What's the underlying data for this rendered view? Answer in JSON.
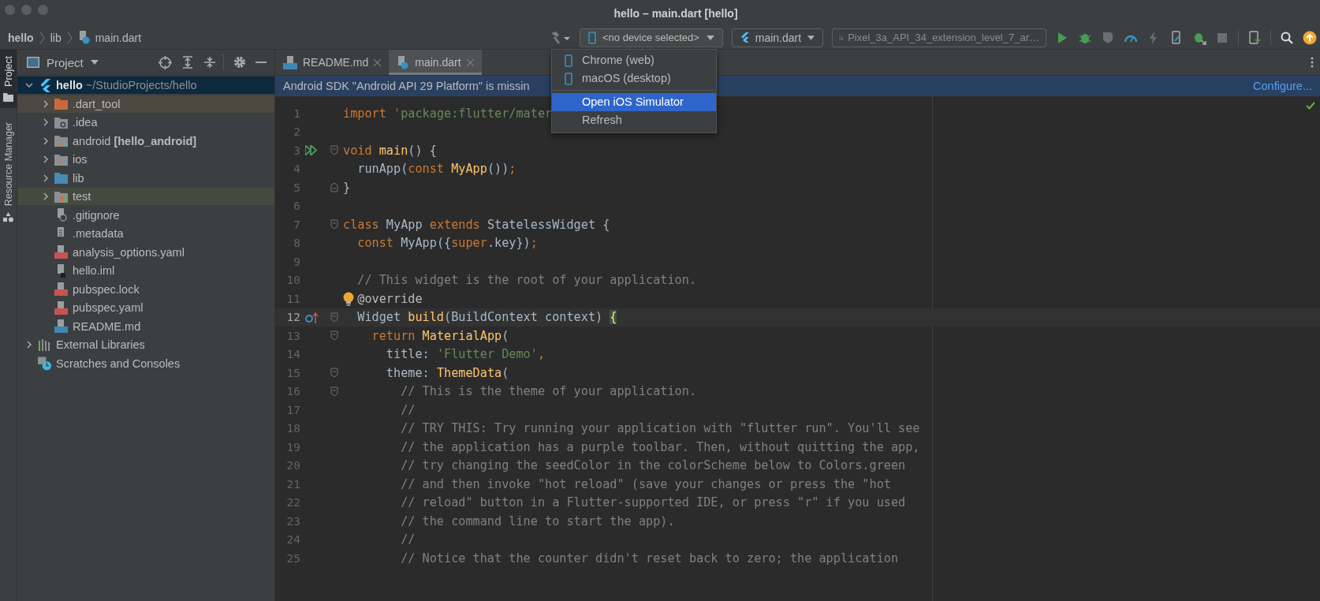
{
  "window": {
    "title": "hello – main.dart [hello]"
  },
  "breadcrumb": [
    {
      "kind": "project",
      "label": "hello"
    },
    {
      "kind": "folder",
      "label": "lib"
    },
    {
      "kind": "file",
      "label": "main.dart"
    }
  ],
  "toolbar": {
    "device_selector": {
      "label": "<no device selected>",
      "expanded": true
    },
    "run_config": "main.dart",
    "target_device": "Pixel_3a_API_34_extension_level_7_ar…",
    "actions": [
      {
        "kind": "run",
        "disabled": false
      },
      {
        "kind": "debug",
        "disabled": false
      },
      {
        "kind": "coverage",
        "disabled": true
      },
      {
        "kind": "profile",
        "disabled": false
      },
      {
        "kind": "hot-reload",
        "disabled": true
      },
      {
        "kind": "device-edit",
        "disabled": false
      },
      {
        "kind": "attach",
        "disabled": false
      },
      {
        "kind": "stop",
        "disabled": true
      },
      {
        "kind": "device-mirror",
        "disabled": false
      },
      {
        "kind": "search",
        "disabled": false
      },
      {
        "kind": "update",
        "disabled": false
      }
    ]
  },
  "device_menu": [
    {
      "kind": "device",
      "label": "Chrome (web)",
      "selected": false
    },
    {
      "kind": "device",
      "label": "macOS (desktop)",
      "selected": false
    },
    {
      "kind": "action",
      "label": "Open iOS Simulator",
      "selected": true
    },
    {
      "kind": "action",
      "label": "Refresh",
      "selected": false
    }
  ],
  "tool_stripe": [
    {
      "label": "Project",
      "selected": true
    },
    {
      "label": "Resource Manager",
      "selected": false
    }
  ],
  "project_panel": {
    "title": "Project",
    "tree": [
      {
        "kind": "project",
        "label": "hello",
        "path": "~/StudioProjects/hello",
        "selected": true,
        "expanded": true,
        "children": [
          {
            "kind": "folder-excluded",
            "label": ".dart_tool",
            "selected": false,
            "expanded": false,
            "color": "#4c4740"
          },
          {
            "kind": "folder-settings",
            "label": ".idea",
            "selected": false,
            "expanded": false
          },
          {
            "kind": "folder-module",
            "label": "android **[hello_android]**",
            "selected": false,
            "expanded": false
          },
          {
            "kind": "folder-module",
            "label": "ios",
            "selected": false,
            "expanded": false
          },
          {
            "kind": "folder-source",
            "label": "lib",
            "selected": false,
            "expanded": false
          },
          {
            "kind": "folder-test",
            "label": "test",
            "selected": false,
            "expanded": false,
            "color": "#454a40"
          },
          {
            "kind": "file-ignore",
            "label": ".gitignore",
            "selected": false
          },
          {
            "kind": "file-text",
            "label": ".metadata",
            "selected": false
          },
          {
            "kind": "file-yaml",
            "label": "analysis_options.yaml",
            "selected": false
          },
          {
            "kind": "file-iml",
            "label": "hello.iml",
            "selected": false
          },
          {
            "kind": "file-yaml",
            "label": "pubspec.lock",
            "selected": false
          },
          {
            "kind": "file-yaml",
            "label": "pubspec.yaml",
            "selected": false
          },
          {
            "kind": "file-md",
            "label": "README.md",
            "selected": false
          }
        ]
      },
      {
        "kind": "libraries",
        "label": "External Libraries",
        "selected": false,
        "expanded": false
      },
      {
        "kind": "scratches",
        "label": "Scratches and Consoles",
        "selected": false
      }
    ]
  },
  "tabs": [
    {
      "kind": "markdown",
      "label": "README.md",
      "selected": false
    },
    {
      "kind": "dart",
      "label": "main.dart",
      "selected": true
    }
  ],
  "banner": {
    "message": "Android SDK \"Android API 29 Platform\" is missin",
    "link": "Configure..."
  },
  "editor": {
    "inspection_ok": true,
    "lines": [
      {
        "number": "1",
        "tokens": [
          {
            "kind": "keyword",
            "text": "import "
          },
          {
            "kind": "string",
            "text": "'package:flutter/mater"
          }
        ]
      },
      {
        "number": "2"
      },
      {
        "number": "3",
        "run_marker": true,
        "fold_start": true,
        "tokens": [
          {
            "kind": "keyword",
            "text": "void "
          },
          {
            "kind": "function",
            "text": "main"
          },
          {
            "kind": "plain",
            "text": "() {"
          }
        ]
      },
      {
        "number": "4",
        "tokens": [
          {
            "kind": "plain",
            "text": "  runApp("
          },
          {
            "kind": "keyword",
            "text": "const "
          },
          {
            "kind": "function",
            "text": "MyApp"
          },
          {
            "kind": "plain",
            "text": "())"
          },
          {
            "kind": "keyword",
            "text": ";"
          }
        ]
      },
      {
        "number": "5",
        "fold_end": true,
        "tokens": [
          {
            "kind": "plain",
            "text": "}"
          }
        ]
      },
      {
        "number": "6"
      },
      {
        "number": "7",
        "fold_start": true,
        "tokens": [
          {
            "kind": "keyword",
            "text": "class"
          },
          {
            "kind": "plain",
            "text": " MyApp "
          },
          {
            "kind": "keyword",
            "text": "extends"
          },
          {
            "kind": "plain",
            "text": " StatelessWidget {"
          }
        ]
      },
      {
        "number": "8",
        "tokens": [
          {
            "kind": "keyword",
            "text": "  const"
          },
          {
            "kind": "plain",
            "text": " MyApp({"
          },
          {
            "kind": "keyword",
            "text": "super"
          },
          {
            "kind": "plain",
            "text": ".key})"
          },
          {
            "kind": "keyword",
            "text": ";"
          }
        ]
      },
      {
        "number": "9"
      },
      {
        "number": "10",
        "tokens": [
          {
            "kind": "comment",
            "text": "  // This widget is the root of your application."
          }
        ]
      },
      {
        "number": "11",
        "bulb": true,
        "tokens": [
          {
            "kind": "annotation",
            "text": "@override"
          }
        ]
      },
      {
        "number": "12",
        "current": true,
        "override_marker": true,
        "fold_start": true,
        "tokens": [
          {
            "kind": "plain",
            "text": "  Widget "
          },
          {
            "kind": "function",
            "text": "build"
          },
          {
            "kind": "plain",
            "text": "(BuildContext context) "
          },
          {
            "kind": "brace-match",
            "text": "{"
          }
        ]
      },
      {
        "number": "13",
        "fold_start": true,
        "tokens": [
          {
            "kind": "keyword",
            "text": "    return "
          },
          {
            "kind": "function",
            "text": "MaterialApp"
          },
          {
            "kind": "plain",
            "text": "("
          }
        ]
      },
      {
        "number": "14",
        "tokens": [
          {
            "kind": "plain",
            "text": "      title: "
          },
          {
            "kind": "string",
            "text": "'Flutter Demo'"
          },
          {
            "kind": "keyword",
            "text": ","
          }
        ]
      },
      {
        "number": "15",
        "fold_start": true,
        "tokens": [
          {
            "kind": "plain",
            "text": "      theme: "
          },
          {
            "kind": "function",
            "text": "ThemeData"
          },
          {
            "kind": "plain",
            "text": "("
          }
        ]
      },
      {
        "number": "16",
        "fold_start": true,
        "tokens": [
          {
            "kind": "comment",
            "text": "        // This is the theme of your application."
          }
        ]
      },
      {
        "number": "17",
        "tokens": [
          {
            "kind": "comment",
            "text": "        //"
          }
        ]
      },
      {
        "number": "18",
        "tokens": [
          {
            "kind": "comment",
            "text": "        // TRY THIS: Try running your application with \"flutter run\". You'll see"
          }
        ]
      },
      {
        "number": "19",
        "tokens": [
          {
            "kind": "comment",
            "text": "        // the application has a purple toolbar. Then, without quitting the app,"
          }
        ]
      },
      {
        "number": "20",
        "tokens": [
          {
            "kind": "comment",
            "text": "        // try changing the seedColor in the colorScheme below to Colors.green"
          }
        ]
      },
      {
        "number": "21",
        "tokens": [
          {
            "kind": "comment",
            "text": "        // and then invoke \"hot reload\" (save your changes or press the \"hot"
          }
        ]
      },
      {
        "number": "22",
        "tokens": [
          {
            "kind": "comment",
            "text": "        // reload\" button in a Flutter-supported IDE, or press \"r\" if you used"
          }
        ]
      },
      {
        "number": "23",
        "tokens": [
          {
            "kind": "comment",
            "text": "        // the command line to start the app)."
          }
        ]
      },
      {
        "number": "24",
        "tokens": [
          {
            "kind": "comment",
            "text": "        //"
          }
        ]
      },
      {
        "number": "25",
        "tokens": [
          {
            "kind": "comment",
            "text": "        // Notice that the counter didn't reset back to zero; the application"
          }
        ]
      }
    ]
  }
}
